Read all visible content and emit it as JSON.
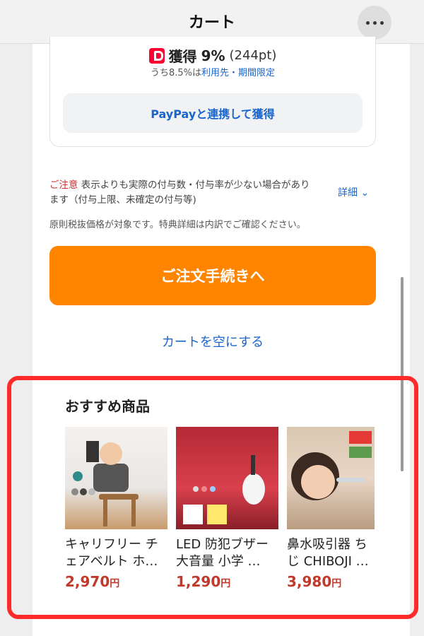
{
  "header": {
    "title": "カート"
  },
  "points": {
    "label": "獲得",
    "rate": "9%",
    "points": "(244pt)",
    "sub_prefix": "うち8.5%は",
    "sub_link": "利用先・期間限定",
    "paypay_button": "PayPayと連携して獲得"
  },
  "notice": {
    "caution": "ご注意",
    "text": " 表示よりも実際の付与数・付与率が少ない場合があります（付与上限、未確定の付与等)",
    "details_link": "詳細 ⌄",
    "note": "原則税抜価格が対象です。特典詳細は内訳でご確認ください。"
  },
  "actions": {
    "checkout": "ご注文手続きへ",
    "empty_cart": "カートを空にする"
  },
  "recommended": {
    "title": "おすすめ商品",
    "items": [
      {
        "name": "キャリフリー チェアベルト ホ…",
        "price": "2,970",
        "unit": "円"
      },
      {
        "name": "LED 防犯ブザー 大音量 小学 …",
        "price": "1,290",
        "unit": "円"
      },
      {
        "name": "鼻水吸引器 ちじ CHIBOJI …",
        "price": "3,980",
        "unit": "円"
      }
    ]
  },
  "colors": {
    "accent": "#ff8400",
    "link": "#1a66cc",
    "price": "#c0392b",
    "highlight": "#ff2b2b"
  }
}
